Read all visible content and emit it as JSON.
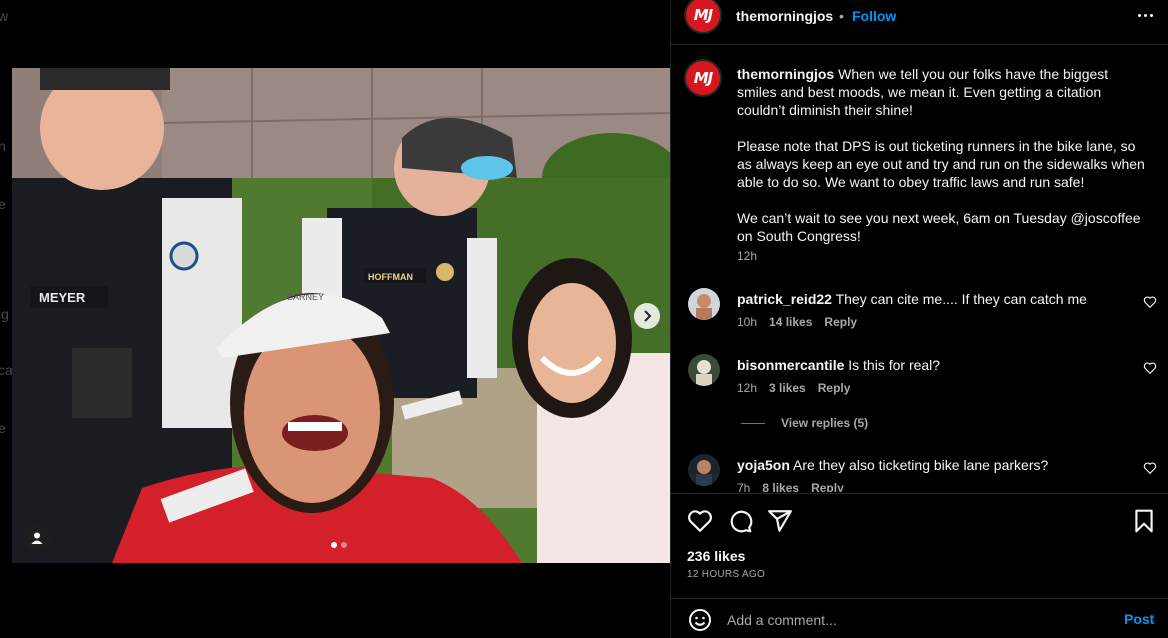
{
  "background_edge_letters": [
    "w",
    "n",
    "e",
    "ig",
    "ca",
    "e"
  ],
  "post": {
    "username": "themorningjos",
    "follow_label": "Follow",
    "separator": "•",
    "avatar_text": "MJ",
    "avatar_color": "#d6171f",
    "image": {
      "total_slides": 2,
      "current_slide": 1,
      "badge_texts": [
        "MEYER",
        "HOFFMAN"
      ],
      "cap_text": "BARNEY"
    }
  },
  "caption": {
    "username": "themorningjos",
    "paragraphs": [
      "When we tell you our folks have the biggest smiles and best moods, we mean it. Even getting a citation couldn’t diminish their shine!",
      "Please note that DPS is out ticketing runners in the bike lane, so as always keep an eye out and try and run on the sidewalks when able to do so. We want to obey traffic laws and run safe!",
      "We can’t wait to see you next week, 6am on Tuesday @joscoffee on South Congress!"
    ],
    "time": "12h"
  },
  "comments": [
    {
      "username": "patrick_reid22",
      "text": "They can cite me.... If they can catch me",
      "time": "10h",
      "likes": "14 likes",
      "reply": "Reply"
    },
    {
      "username": "bisonmercantile",
      "text": "Is this for real?",
      "time": "12h",
      "likes": "3 likes",
      "reply": "Reply"
    },
    {
      "username": "yoja5on",
      "text": "Are they also ticketing bike lane parkers?",
      "time": "7h",
      "likes": "8 likes",
      "reply": "Reply"
    }
  ],
  "view_replies": "View replies (5)",
  "stats": {
    "likes": "236 likes",
    "time_ago": "12 HOURS AGO"
  },
  "comment_box": {
    "placeholder": "Add a comment...",
    "post_label": "Post"
  },
  "colors": {
    "background": "#000000",
    "text": "#f5f5f5",
    "secondary_text": "#a8a8a8",
    "link_blue": "#0095f6",
    "divider": "#262626"
  }
}
